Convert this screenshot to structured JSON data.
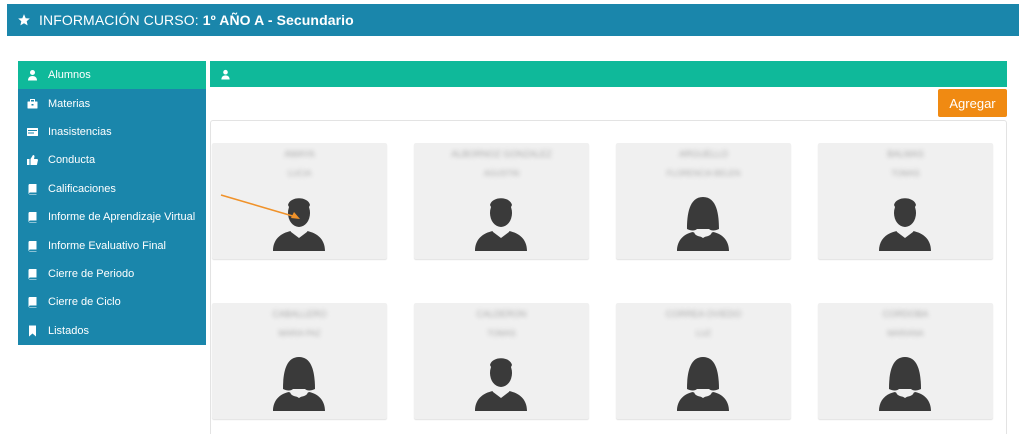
{
  "header": {
    "prefix": "INFORMACIÓN CURSO: ",
    "course": "1º AÑO A - Secundario"
  },
  "sidebar": {
    "items": [
      {
        "label": "Alumnos",
        "icon": "user-icon",
        "active": true
      },
      {
        "label": "Materias",
        "icon": "briefcase-icon",
        "active": false
      },
      {
        "label": "Inasistencias",
        "icon": "card-icon",
        "active": false
      },
      {
        "label": "Conducta",
        "icon": "thumbs-up-icon",
        "active": false
      },
      {
        "label": "Calificaciones",
        "icon": "book-icon",
        "active": false
      },
      {
        "label": "Informe de Aprendizaje Virtual",
        "icon": "book-icon",
        "active": false
      },
      {
        "label": "Informe Evaluativo Final",
        "icon": "book-icon",
        "active": false
      },
      {
        "label": "Cierre de Periodo",
        "icon": "book-icon",
        "active": false
      },
      {
        "label": "Cierre de Ciclo",
        "icon": "book-icon",
        "active": false
      },
      {
        "label": "Listados",
        "icon": "bookmark-icon",
        "active": false
      }
    ]
  },
  "toolbar": {
    "add_label": "Agregar"
  },
  "colors": {
    "primary": "#1a86ab",
    "accent": "#0fb99a",
    "button": "#f08a12"
  },
  "students": [
    {
      "name": "AMAYA",
      "sub": "LUCIA",
      "avatar": "male-avatar-icon"
    },
    {
      "name": "ALBORNOZ GONZALEZ",
      "sub": "AGUSTIN",
      "avatar": "male-avatar-icon"
    },
    {
      "name": "ARGUELLO",
      "sub": "FLORENCIA BELEN",
      "avatar": "female-avatar-icon"
    },
    {
      "name": "BALMAS",
      "sub": "TOMAS",
      "avatar": "male-avatar-icon"
    },
    {
      "name": "CABALLERO",
      "sub": "MARIA PAZ",
      "avatar": "female-avatar-icon"
    },
    {
      "name": "CALDERON",
      "sub": "TOMAS",
      "avatar": "male-avatar-icon"
    },
    {
      "name": "CORREA OVIEDO",
      "sub": "LUZ",
      "avatar": "female-avatar-icon"
    },
    {
      "name": "CORDOBA",
      "sub": "MARIANA",
      "avatar": "female-avatar-icon"
    }
  ]
}
